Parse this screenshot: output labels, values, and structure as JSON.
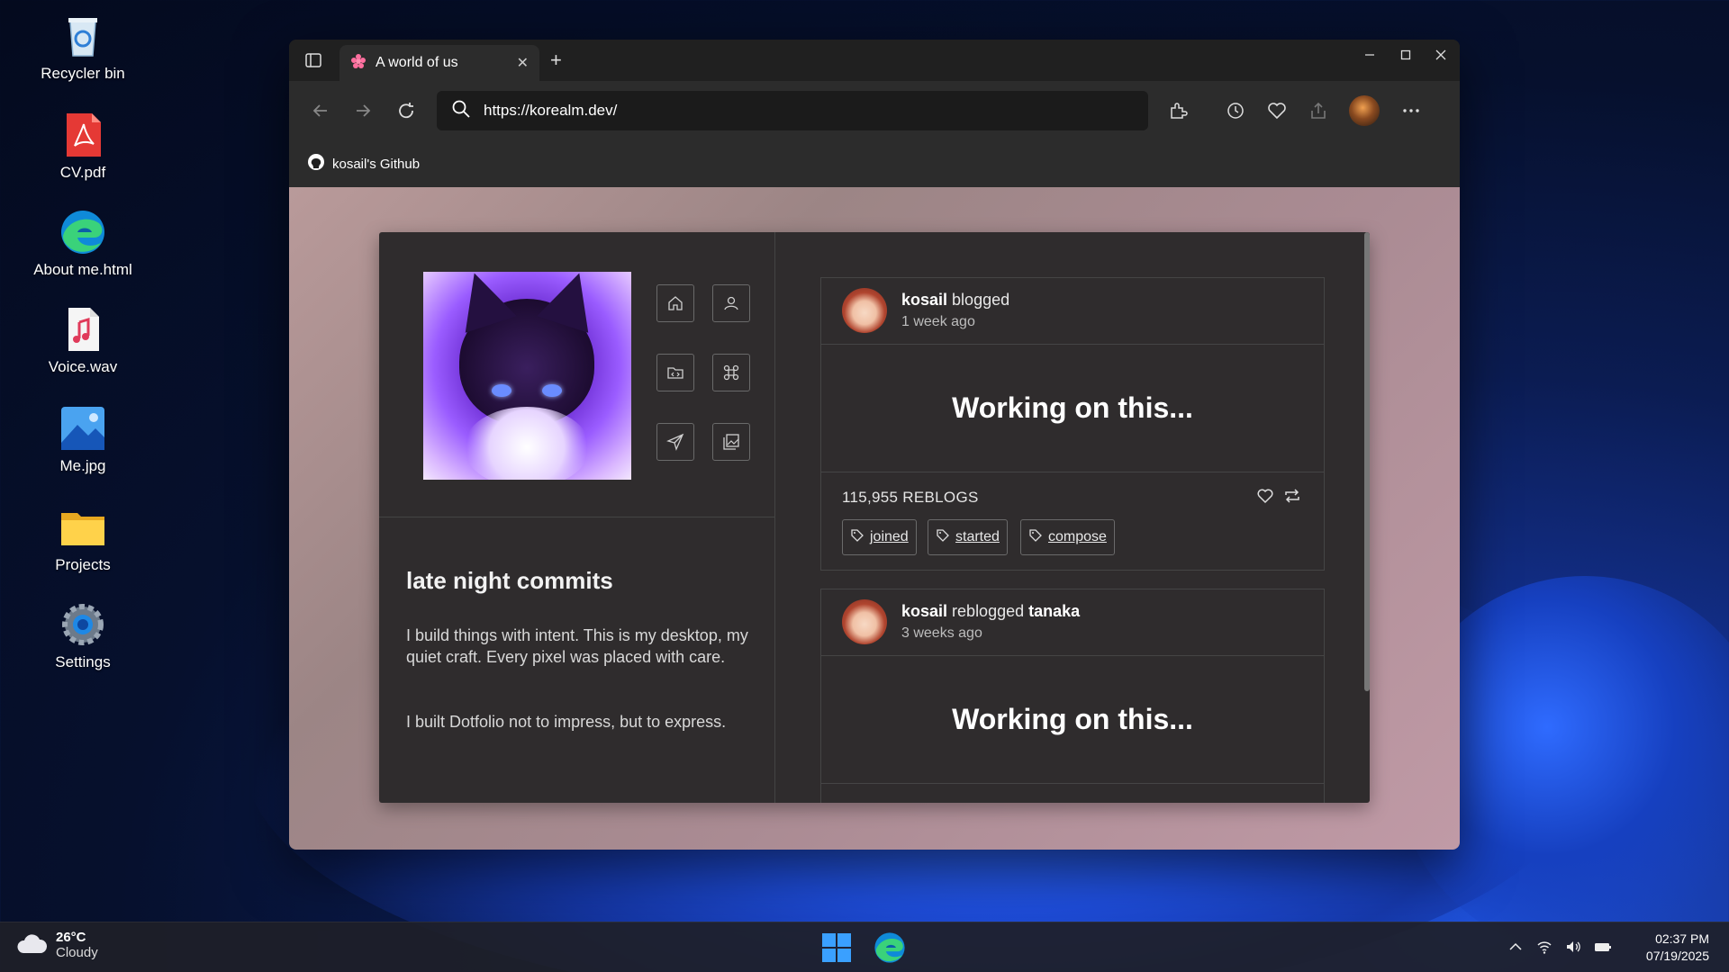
{
  "desktop": {
    "icons": [
      {
        "label": "Recycler bin",
        "icon": "recycle-bin-icon"
      },
      {
        "label": "CV.pdf",
        "icon": "pdf-icon"
      },
      {
        "label": "About me.html",
        "icon": "edge-icon"
      },
      {
        "label": "Voice.wav",
        "icon": "audio-file-icon"
      },
      {
        "label": "Me.jpg",
        "icon": "image-file-icon"
      },
      {
        "label": "Projects",
        "icon": "folder-icon"
      },
      {
        "label": "Settings",
        "icon": "settings-gear-icon"
      }
    ]
  },
  "browser": {
    "tab_title": "A world of us",
    "new_tab": "+",
    "tab_close": "✕",
    "url": "https://korealm.dev/",
    "bookmark": "kosail's Github"
  },
  "profile": {
    "title": "late night commits",
    "bio_1": "I build things with intent. This is my desktop, my quiet craft. Every pixel was placed with care.",
    "bio_2": "I built Dotfolio not to impress, but to express.",
    "nav_icons": [
      "home-icon",
      "user-icon",
      "code-folder-icon",
      "command-icon",
      "send-icon",
      "gallery-icon"
    ]
  },
  "posts": [
    {
      "user": "kosail",
      "action": "blogged",
      "target": "",
      "time": "1 week ago",
      "body": "Working on this...",
      "reblogs": "115,955 REBLOGS",
      "tags": [
        "joined",
        "started",
        "compose"
      ]
    },
    {
      "user": "kosail",
      "action": "reblogged",
      "target": "tanaka",
      "time": "3 weeks ago",
      "body": "Working on this..."
    }
  ],
  "taskbar": {
    "temp": "26°C",
    "condition": "Cloudy",
    "time": "02:37 PM",
    "date": "07/19/2025"
  },
  "colors": {
    "card_bg": "#2f2c2d",
    "viewport_bg": "#b99a9a",
    "browser_chrome": "#2c2c2c"
  }
}
